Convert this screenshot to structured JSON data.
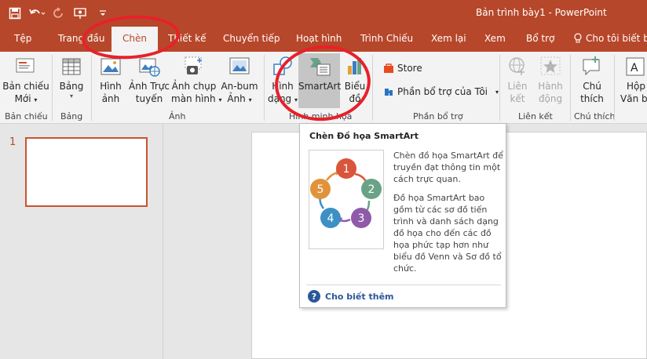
{
  "titlebar": {
    "title": "Bản trình bày1 - PowerPoint",
    "quick_access": [
      "save-icon",
      "undo-icon",
      "redo-icon",
      "start-slideshow-icon",
      "customize-qat-icon"
    ]
  },
  "tabs": [
    {
      "label": "Tệp",
      "active": false
    },
    {
      "label": "Trang đầu",
      "active": false
    },
    {
      "label": "Chèn",
      "active": true
    },
    {
      "label": "Thiết kế",
      "active": false
    },
    {
      "label": "Chuyển tiếp",
      "active": false
    },
    {
      "label": "Hoạt hình",
      "active": false
    },
    {
      "label": "Trình Chiếu",
      "active": false
    },
    {
      "label": "Xem lại",
      "active": false
    },
    {
      "label": "Xem",
      "active": false
    },
    {
      "label": "Bổ trợ",
      "active": false
    },
    {
      "label": "Cho tôi biết bạn",
      "active": false
    }
  ],
  "ribbon": {
    "new_slide": {
      "line1": "Bản chiếu",
      "line2": "Mới"
    },
    "table": {
      "line1": "Bảng"
    },
    "pictures": {
      "line1": "Hình",
      "line2": "ảnh"
    },
    "online_pictures": {
      "line1": "Ảnh Trực",
      "line2": "tuyến"
    },
    "screenshot": {
      "line1": "Ảnh chụp",
      "line2": "màn hình"
    },
    "photo_album": {
      "line1": "An-bum",
      "line2": "Ảnh"
    },
    "shapes": {
      "line1": "Hình",
      "line2": "dạng"
    },
    "smartart": {
      "line1": "SmartArt"
    },
    "chart": {
      "line1": "Biểu",
      "line2": "đồ"
    },
    "store": {
      "label": "Store"
    },
    "my_addins": {
      "label": "Phần bổ trợ của Tôi"
    },
    "link": {
      "line1": "Liên",
      "line2": "kết"
    },
    "action": {
      "line1": "Hành",
      "line2": "động"
    },
    "comment": {
      "line1": "Chú",
      "line2": "thích"
    },
    "textbox": {
      "line1": "Hộp",
      "line2": "Văn bả"
    },
    "groups": {
      "slides": "Bản chiếu",
      "tables": "Bảng",
      "images": "Ảnh",
      "illustrations": "Hình minh họa",
      "addins": "Phần bổ trợ",
      "links": "Liên kết",
      "comments": "Chú thích"
    }
  },
  "slides_pane": {
    "number": "1"
  },
  "tooltip": {
    "title": "Chèn Đồ họa SmartArt",
    "para1": "Chèn đồ họa SmartArt để truyền đạt thông tin một cách trực quan.",
    "para2": "Đồ họa SmartArt bao gồm từ các sơ đồ tiến trình và danh sách dạng đồ họa cho đến các đồ họa phức tạp hơn như biểu đồ Venn và Sơ đồ tổ chức.",
    "help_link": "Cho biết thêm",
    "diagram_numbers": [
      "1",
      "2",
      "3",
      "4",
      "5"
    ],
    "diagram_colors": [
      "#d9553b",
      "#6aa287",
      "#8f5aa8",
      "#3c90c4",
      "#e0933a"
    ]
  },
  "colors": {
    "accent": "#b7472a",
    "annotation": "#e8202a",
    "link": "#2b579a"
  }
}
